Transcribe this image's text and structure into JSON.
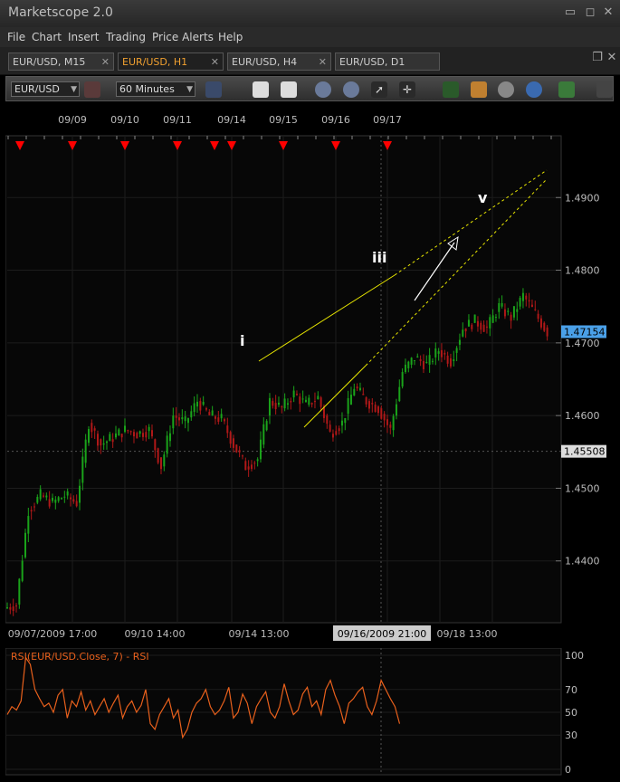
{
  "app": {
    "title": "Marketscope 2.0",
    "minimize": "▭",
    "maximize": "◻",
    "close": "✕"
  },
  "menu": [
    "File",
    "Chart",
    "Insert",
    "Trading",
    "Price Alerts",
    "Help"
  ],
  "tabs": [
    {
      "label": "EUR/USD, M15",
      "active": false
    },
    {
      "label": "EUR/USD, H1",
      "active": true
    },
    {
      "label": "EUR/USD, H4",
      "active": false
    },
    {
      "label": "EUR/USD, D1",
      "active": false
    }
  ],
  "toolbar": {
    "instrument": "EUR/USD",
    "timeframe": "60 Minutes"
  },
  "chart_data": {
    "type": "candlestick",
    "instrument": "EUR/USD",
    "timeframe": "H1",
    "top_date_labels": [
      "09/09",
      "09/10",
      "09/11",
      "09/14",
      "09/15",
      "09/16",
      "09/17"
    ],
    "bottom_time_labels": [
      "09/07/2009 17:00",
      "09/10 14:00",
      "09/14 13:00",
      "09/16/2009 21:00",
      "09/18 13:00"
    ],
    "price_ticks": [
      "1.4900",
      "1.4800",
      "1.4700",
      "1.4600",
      "1.4500",
      "1.4400"
    ],
    "price_tick_values": [
      1.49,
      1.48,
      1.47,
      1.46,
      1.45,
      1.44
    ],
    "ylim": [
      1.4315,
      1.4985
    ],
    "current_price": "1.47154",
    "crosshair_price": "1.45508",
    "wave_labels": [
      "i",
      "iii",
      "v"
    ],
    "price_path": [
      [
        0,
        1.4335
      ],
      [
        2,
        1.434
      ],
      [
        4,
        1.447
      ],
      [
        6,
        1.449
      ],
      [
        8,
        1.448
      ],
      [
        10,
        1.449
      ],
      [
        12,
        1.448
      ],
      [
        14,
        1.459
      ],
      [
        16,
        1.456
      ],
      [
        18,
        1.457
      ],
      [
        20,
        1.458
      ],
      [
        22,
        1.4575
      ],
      [
        24,
        1.458
      ],
      [
        26,
        1.453
      ],
      [
        28,
        1.46
      ],
      [
        30,
        1.459
      ],
      [
        32,
        1.462
      ],
      [
        34,
        1.46
      ],
      [
        36,
        1.4595
      ],
      [
        38,
        1.456
      ],
      [
        40,
        1.453
      ],
      [
        42,
        1.454
      ],
      [
        44,
        1.462
      ],
      [
        46,
        1.461
      ],
      [
        48,
        1.463
      ],
      [
        50,
        1.4615
      ],
      [
        52,
        1.4625
      ],
      [
        54,
        1.4575
      ],
      [
        56,
        1.459
      ],
      [
        58,
        1.464
      ],
      [
        60,
        1.462
      ],
      [
        62,
        1.461
      ],
      [
        64,
        1.458
      ],
      [
        66,
        1.466
      ],
      [
        68,
        1.468
      ],
      [
        70,
        1.467
      ],
      [
        72,
        1.469
      ],
      [
        74,
        1.4675
      ],
      [
        76,
        1.472
      ],
      [
        78,
        1.473
      ],
      [
        80,
        1.472
      ],
      [
        82,
        1.475
      ],
      [
        84,
        1.4735
      ],
      [
        86,
        1.4765
      ],
      [
        88,
        1.474
      ],
      [
        90,
        1.4715
      ]
    ],
    "rsi": {
      "label": "RSI(EUR/USD.Close, 7) - RSI",
      "ticks": [
        "100",
        "70",
        "50",
        "30",
        "0"
      ],
      "tick_values": [
        100,
        70,
        50,
        30,
        0
      ],
      "values": [
        48,
        55,
        52,
        60,
        98,
        92,
        70,
        62,
        55,
        58,
        50,
        65,
        70,
        45,
        60,
        55,
        68,
        52,
        60,
        48,
        55,
        62,
        50,
        58,
        65,
        45,
        55,
        60,
        50,
        56,
        70,
        40,
        35,
        48,
        55,
        62,
        45,
        52,
        28,
        35,
        50,
        58,
        62,
        70,
        55,
        48,
        52,
        60,
        72,
        45,
        50,
        66,
        58,
        40,
        55,
        62,
        68,
        50,
        45,
        55,
        75,
        60,
        48,
        52,
        66,
        72,
        55,
        60,
        48,
        70,
        78,
        65,
        55,
        40,
        58,
        62,
        68,
        72,
        55,
        48,
        60,
        78,
        70,
        62,
        55,
        40
      ]
    },
    "colors": {
      "up": "#1aa31a",
      "down": "#b01818",
      "trendline": "#e8e600",
      "arrow": "#ffffff",
      "rsi": "#e8601c",
      "grid": "#1c1c1c",
      "marker": "#ff0000",
      "price_tag": "#4aa0e8"
    }
  }
}
